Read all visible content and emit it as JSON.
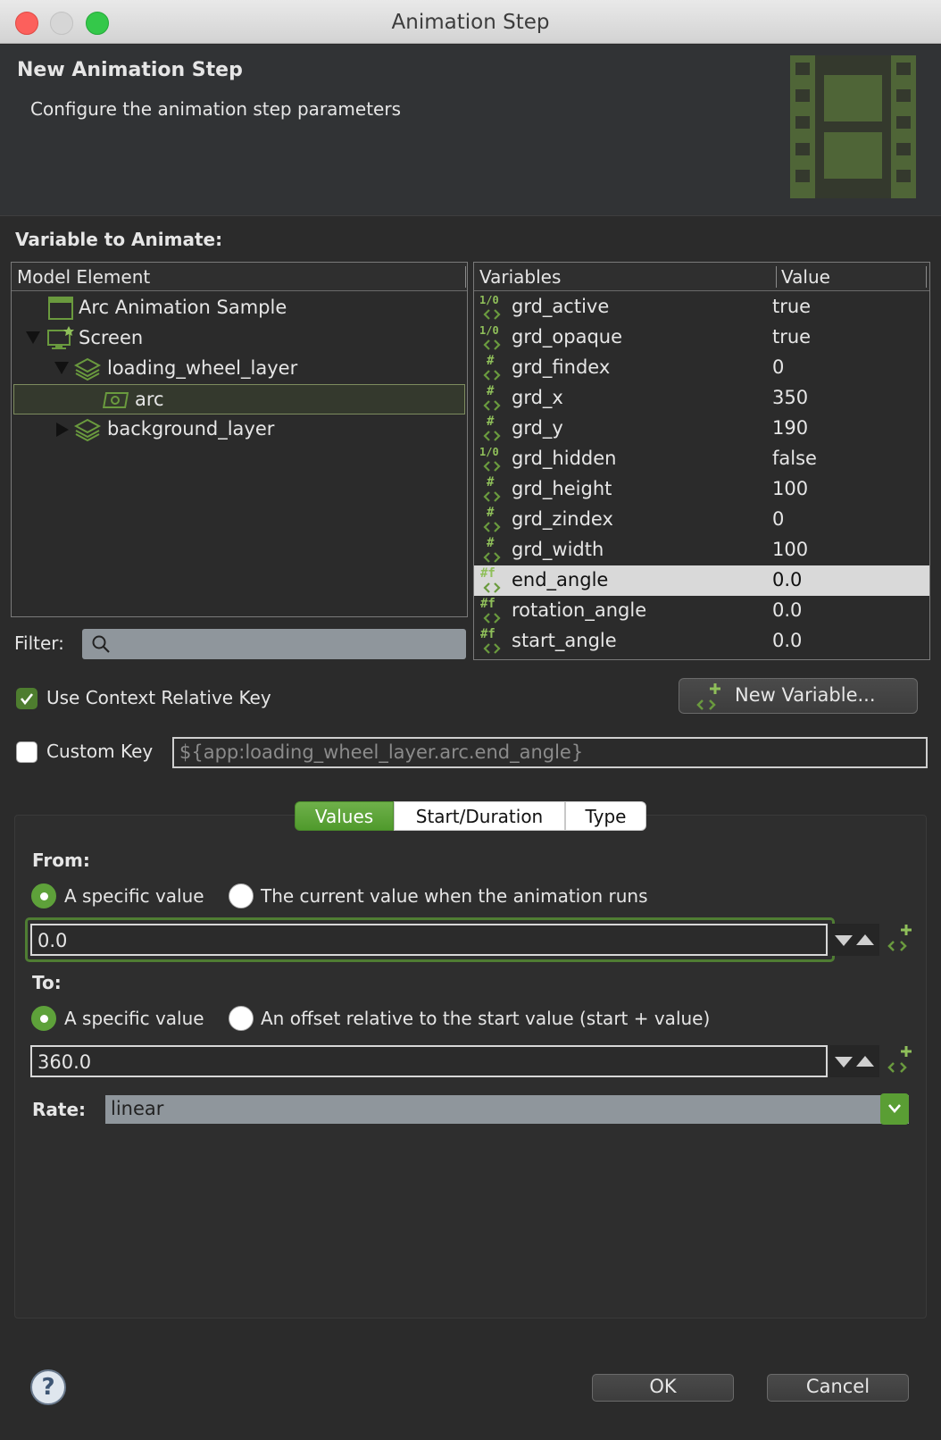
{
  "window": {
    "title": "Animation Step"
  },
  "header": {
    "title": "New Animation Step",
    "subtitle": "Configure the animation step parameters",
    "icon": "film-strip-icon"
  },
  "variable_section": {
    "label": "Variable to Animate:"
  },
  "model_tree": {
    "column": "Model Element",
    "items": [
      {
        "label": "Arc Animation Sample",
        "icon": "application-icon",
        "depth": 1,
        "twisty": "none"
      },
      {
        "label": "Screen",
        "icon": "screen-icon",
        "depth": 1,
        "twisty": "expanded"
      },
      {
        "label": "loading_wheel_layer",
        "icon": "layer-icon",
        "depth": 2,
        "twisty": "expanded"
      },
      {
        "label": "arc",
        "icon": "control-icon",
        "depth": 3,
        "twisty": "none",
        "selected": true
      },
      {
        "label": "background_layer",
        "icon": "layer-icon",
        "depth": 2,
        "twisty": "collapsed"
      }
    ]
  },
  "variables_table": {
    "columns": [
      "Variables",
      "Value"
    ],
    "rows": [
      {
        "name": "grd_active",
        "value": "true",
        "type": "1/0"
      },
      {
        "name": "grd_opaque",
        "value": "true",
        "type": "1/0"
      },
      {
        "name": "grd_findex",
        "value": "0",
        "type": "#"
      },
      {
        "name": "grd_x",
        "value": "350",
        "type": "#"
      },
      {
        "name": "grd_y",
        "value": "190",
        "type": "#"
      },
      {
        "name": "grd_hidden",
        "value": "false",
        "type": "1/0"
      },
      {
        "name": "grd_height",
        "value": "100",
        "type": "#"
      },
      {
        "name": "grd_zindex",
        "value": "0",
        "type": "#"
      },
      {
        "name": "grd_width",
        "value": "100",
        "type": "#"
      },
      {
        "name": "end_angle",
        "value": "0.0",
        "type": "#f",
        "selected": true
      },
      {
        "name": "rotation_angle",
        "value": "0.0",
        "type": "#f"
      },
      {
        "name": "start_angle",
        "value": "0.0",
        "type": "#f"
      }
    ]
  },
  "filter": {
    "label": "Filter:",
    "value": ""
  },
  "context_key": {
    "label": "Use Context Relative Key",
    "checked": true
  },
  "new_variable": {
    "label": "New Variable..."
  },
  "custom_key": {
    "label": "Custom Key",
    "checked": false,
    "placeholder": "${app:loading_wheel_layer.arc.end_angle}"
  },
  "tabs": [
    {
      "label": "Values",
      "active": true
    },
    {
      "label": "Start/Duration",
      "active": false
    },
    {
      "label": "Type",
      "active": false
    }
  ],
  "from": {
    "label": "From:",
    "option_specific": "A specific value",
    "option_current": "The current value when the animation runs",
    "selected": "specific",
    "value": "0.0"
  },
  "to": {
    "label": "To:",
    "option_specific": "A specific value",
    "option_offset": "An offset relative to the start value (start + value)",
    "selected": "specific",
    "value": "360.0"
  },
  "rate": {
    "label": "Rate:",
    "value": "linear"
  },
  "footer": {
    "ok": "OK",
    "cancel": "Cancel",
    "help": "?"
  },
  "colors": {
    "accent_green": "#5ea13a",
    "selection": "#d9d9d9",
    "background": "#2b2b2b"
  }
}
